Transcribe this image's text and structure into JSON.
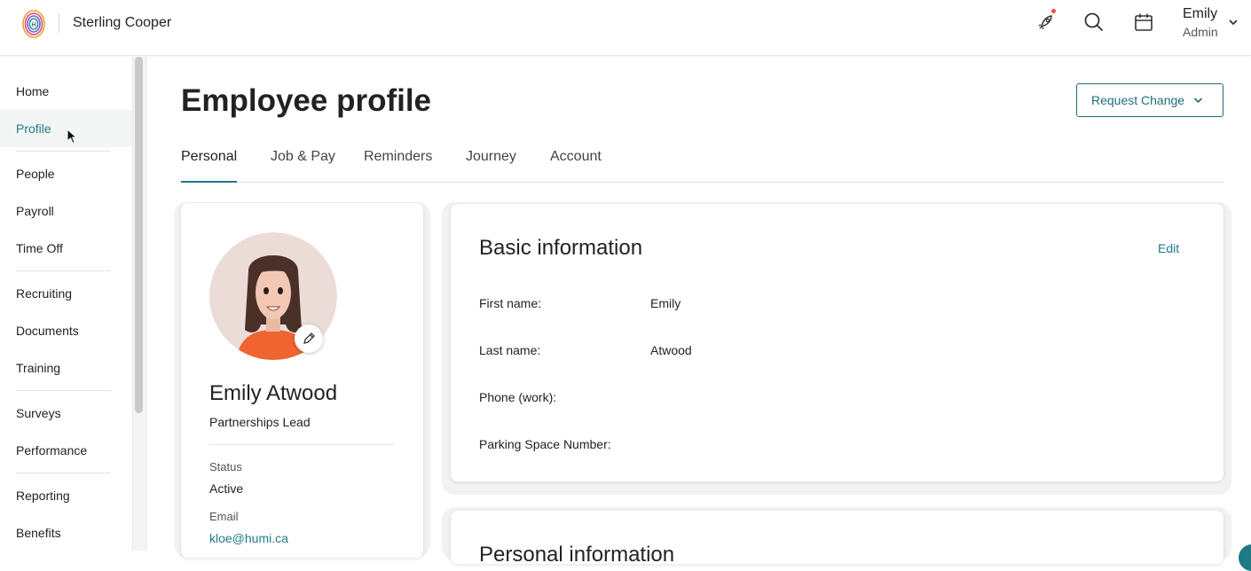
{
  "header": {
    "company": "Sterling Cooper",
    "user_name": "Emily",
    "user_role": "Admin",
    "icons": [
      "rocket-icon",
      "search-icon",
      "calendar-icon",
      "chevron-down-icon"
    ],
    "notification_color": "#e5533d"
  },
  "sidebar": {
    "items": [
      {
        "label": "Home"
      },
      {
        "label": "Profile"
      },
      {
        "label": "People"
      },
      {
        "label": "Payroll"
      },
      {
        "label": "Time Off"
      },
      {
        "label": "Recruiting"
      },
      {
        "label": "Documents"
      },
      {
        "label": "Training"
      },
      {
        "label": "Surveys"
      },
      {
        "label": "Performance"
      },
      {
        "label": "Reporting"
      },
      {
        "label": "Benefits"
      }
    ],
    "active": "Profile"
  },
  "page": {
    "title": "Employee profile",
    "request_change": "Request Change",
    "tabs": [
      {
        "label": "Personal"
      },
      {
        "label": "Job & Pay"
      },
      {
        "label": "Reminders"
      },
      {
        "label": "Journey"
      },
      {
        "label": "Account"
      }
    ],
    "active_tab": "Personal"
  },
  "profile": {
    "name": "Emily Atwood",
    "job_title": "Partnerships Lead",
    "status_label": "Status",
    "status_value": "Active",
    "email_label": "Email",
    "email_value": "kloe@humi.ca"
  },
  "basic_info": {
    "title": "Basic information",
    "edit": "Edit",
    "fields": [
      {
        "label": "First name:",
        "value": "Emily"
      },
      {
        "label": "Last name:",
        "value": "Atwood"
      },
      {
        "label": "Phone (work):",
        "value": ""
      },
      {
        "label": "Parking Space Number:",
        "value": ""
      }
    ]
  },
  "personal_info": {
    "title": "Personal information"
  },
  "colors": {
    "accent": "#1f7a84",
    "active_nav_bg": "#f3f5f5"
  }
}
